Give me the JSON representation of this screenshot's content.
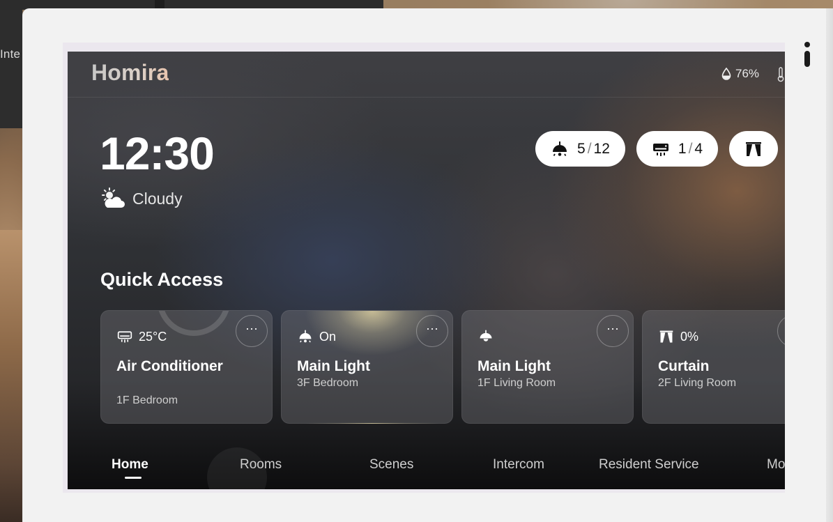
{
  "background": {
    "left_partial_text": "Inte"
  },
  "header": {
    "logo": "Homira",
    "humidity": "76%"
  },
  "clock": {
    "time": "12:30",
    "weather": "Cloudy"
  },
  "status_pills": [
    {
      "icon": "ceiling-light-icon",
      "active": "5",
      "total": "12"
    },
    {
      "icon": "air-conditioner-icon",
      "active": "1",
      "total": "4"
    },
    {
      "icon": "curtain-icon"
    }
  ],
  "quick_access": {
    "title": "Quick Access",
    "cards": [
      {
        "icon": "air-conditioner-icon",
        "status": "25°C",
        "name": "Air Conditioner",
        "room": "1F Bedroom",
        "more": "···"
      },
      {
        "icon": "ceiling-light-icon",
        "status": "On",
        "name": "Main Light",
        "room": "3F Bedroom",
        "more": "···"
      },
      {
        "icon": "pendant-light-icon",
        "status": "",
        "name": "Main Light",
        "room": "1F Living Room",
        "more": "···"
      },
      {
        "icon": "curtain-icon",
        "status": "0%",
        "name": "Curtain",
        "room": "2F Living Room",
        "more": "···"
      }
    ]
  },
  "nav": {
    "items": [
      "Home",
      "Rooms",
      "Scenes",
      "Intercom",
      "Resident Service",
      "Mo"
    ],
    "active": "Home"
  },
  "colors": {
    "frame": "#f2f2f2",
    "pill_bg": "#ffffff",
    "text_primary": "#ffffff"
  }
}
